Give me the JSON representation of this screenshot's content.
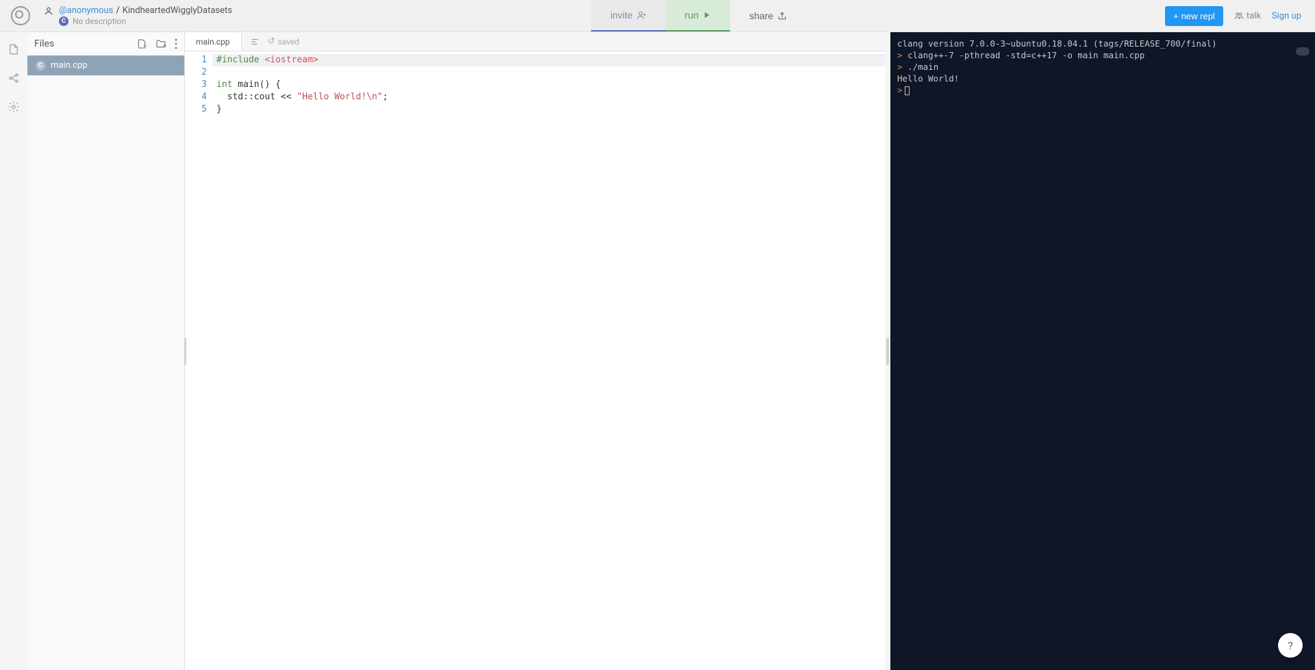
{
  "header": {
    "user": "@anonymous",
    "repl_name": "KindheartedWigglyDatasets",
    "description": "No description",
    "invite": "invite",
    "run": "run",
    "share": "share",
    "new_repl": "new repl",
    "talk": "talk",
    "signup": "Sign up"
  },
  "files": {
    "label": "Files",
    "items": [
      {
        "name": "main.cpp"
      }
    ]
  },
  "editor": {
    "tab": "main.cpp",
    "saved": "saved",
    "lines": [
      "1",
      "2",
      "3",
      "4",
      "5"
    ],
    "src": {
      "l1_include": "#include",
      "l1_header": "<iostream>",
      "l3_kw_int": "int",
      "l3_main": " main() {",
      "l4_indent": "  std::cout << ",
      "l4_str": "\"Hello World!\\n\"",
      "l4_semi": ";",
      "l5_brace": "}"
    }
  },
  "terminal": {
    "lines": [
      {
        "prompt": false,
        "text": "clang version 7.0.0-3~ubuntu0.18.04.1 (tags/RELEASE_700/final)"
      },
      {
        "prompt": true,
        "text": "clang++-7 -pthread -std=c++17 -o main main.cpp"
      },
      {
        "prompt": true,
        "text": "./main"
      },
      {
        "prompt": false,
        "text": "Hello World!"
      }
    ]
  },
  "help": "?"
}
